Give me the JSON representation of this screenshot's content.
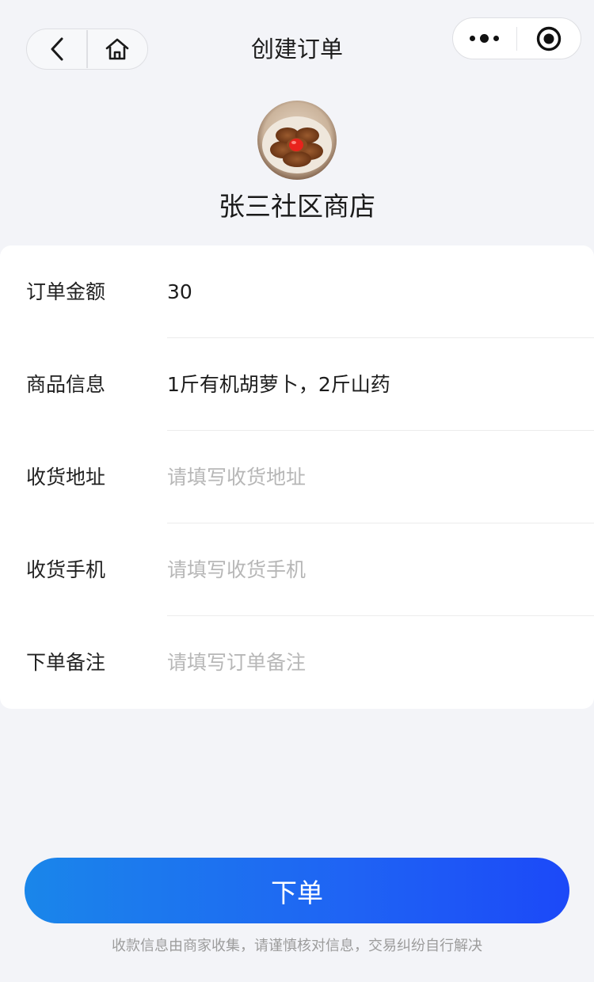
{
  "nav": {
    "title": "创建订单",
    "back_icon": "chevron-left-icon",
    "home_icon": "home-icon",
    "more_icon": "more-dots-icon",
    "close_icon": "target-circle-icon"
  },
  "store": {
    "name": "张三社区商店",
    "avatar_icon": "store-avatar-food-image"
  },
  "form": {
    "rows": [
      {
        "label": "订单金额",
        "value": "30"
      },
      {
        "label": "商品信息",
        "value": "1斤有机胡萝卜，2斤山药"
      },
      {
        "label": "收货地址",
        "placeholder": "请填写收货地址"
      },
      {
        "label": "收货手机",
        "placeholder": "请填写收货手机"
      },
      {
        "label": "下单备注",
        "placeholder": "请填写订单备注"
      }
    ]
  },
  "submit": {
    "label": "下单"
  },
  "disclaimer": "收款信息由商家收集，请谨慎核对信息，交易纠纷自行解决",
  "colors": {
    "background": "#f3f4f8",
    "button_start": "#1a86ea",
    "button_end": "#1c49f8",
    "placeholder": "#b7b7b7",
    "disclaimer": "#9c9c9c"
  }
}
